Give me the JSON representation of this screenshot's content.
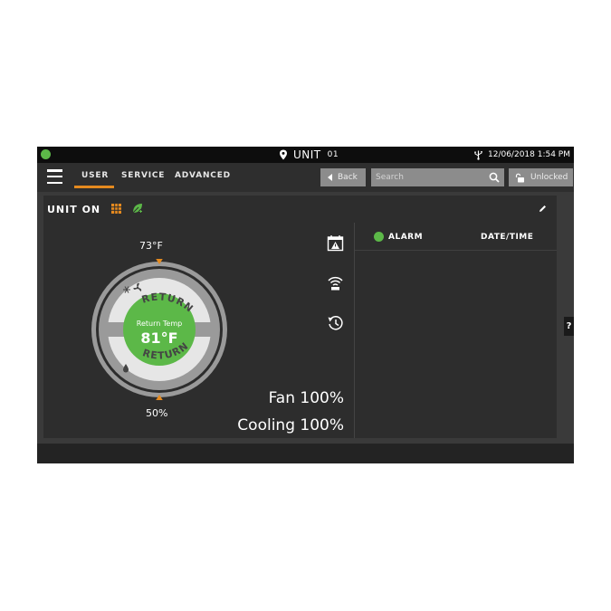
{
  "status_bar": {
    "unit_label": "UNIT",
    "unit_number": "01",
    "datetime": "12/06/2018 1:54 PM",
    "status_color": "#5cb848"
  },
  "nav": {
    "tabs": [
      {
        "label": "USER",
        "active": true
      },
      {
        "label": "SERVICE",
        "active": false
      },
      {
        "label": "ADVANCED",
        "active": false
      }
    ],
    "back_label": "Back",
    "search_placeholder": "Search",
    "lock_label": "Unlocked",
    "accent_color": "#e58a1f"
  },
  "unit": {
    "status_text": "UNIT ON"
  },
  "dial": {
    "top_setpoint": "73°F",
    "bottom_setpoint": "50%",
    "top_arc_label": "RETURN",
    "bottom_arc_label": "RETURN",
    "center_label": "Return Temp",
    "center_value": "81°F",
    "center_color": "#5cb848"
  },
  "readouts": {
    "fan": "Fan 100%",
    "cooling": "Cooling 100%"
  },
  "alarms": {
    "alarm_header": "ALARM",
    "date_header": "DATE/TIME"
  },
  "icons": {
    "side_top": "calendar-alarm-icon",
    "side_middle": "wireless-icon",
    "side_bottom": "history-icon"
  },
  "help": {
    "label": "?"
  }
}
